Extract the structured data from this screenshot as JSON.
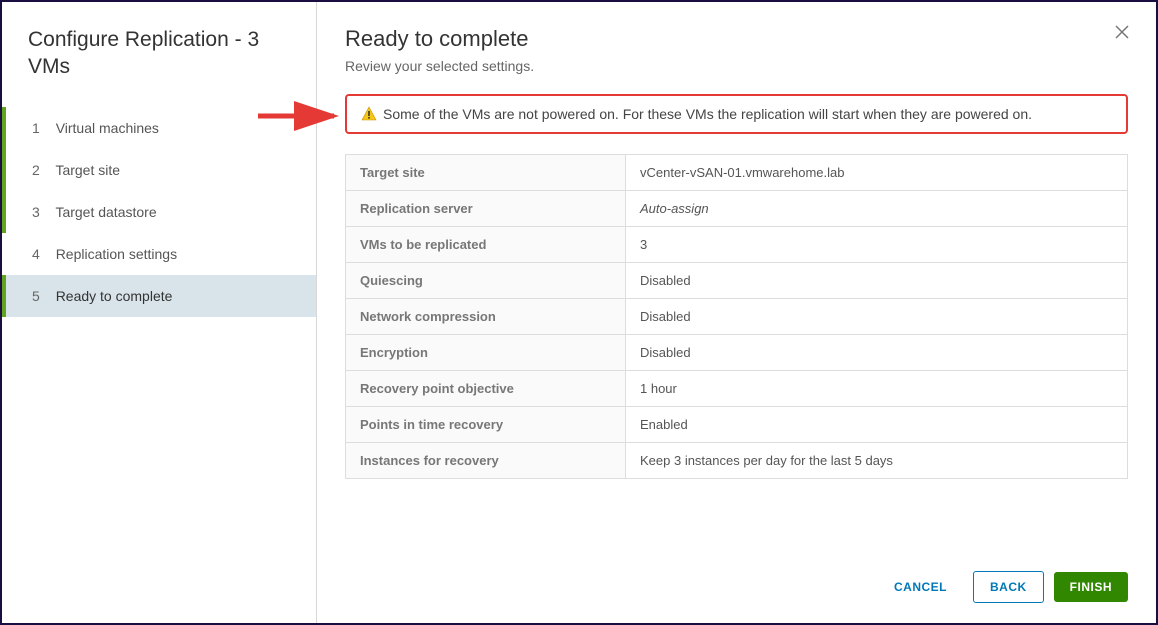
{
  "wizard": {
    "title": "Configure Replication - 3 VMs",
    "steps": [
      {
        "num": "1",
        "label": "Virtual machines"
      },
      {
        "num": "2",
        "label": "Target site"
      },
      {
        "num": "3",
        "label": "Target datastore"
      },
      {
        "num": "4",
        "label": "Replication settings"
      },
      {
        "num": "5",
        "label": "Ready to complete"
      }
    ]
  },
  "page": {
    "title": "Ready to complete",
    "subtitle": "Review your selected settings."
  },
  "warning": {
    "text": "Some of the VMs are not powered on. For these VMs the replication will start when they are powered on."
  },
  "settings": {
    "rows": [
      {
        "label": "Target site",
        "value": "vCenter-vSAN-01.vmwarehome.lab",
        "italic": false
      },
      {
        "label": "Replication server",
        "value": "Auto-assign",
        "italic": true
      },
      {
        "label": "VMs to be replicated",
        "value": "3",
        "italic": false
      },
      {
        "label": "Quiescing",
        "value": "Disabled",
        "italic": false
      },
      {
        "label": "Network compression",
        "value": "Disabled",
        "italic": false
      },
      {
        "label": "Encryption",
        "value": "Disabled",
        "italic": false
      },
      {
        "label": "Recovery point objective",
        "value": "1 hour",
        "italic": false
      },
      {
        "label": "Points in time recovery",
        "value": "Enabled",
        "italic": false
      },
      {
        "label": "Instances for recovery",
        "value": "Keep 3 instances per day for the last 5 days",
        "italic": false
      }
    ]
  },
  "buttons": {
    "cancel": "CANCEL",
    "back": "BACK",
    "finish": "FINISH"
  }
}
